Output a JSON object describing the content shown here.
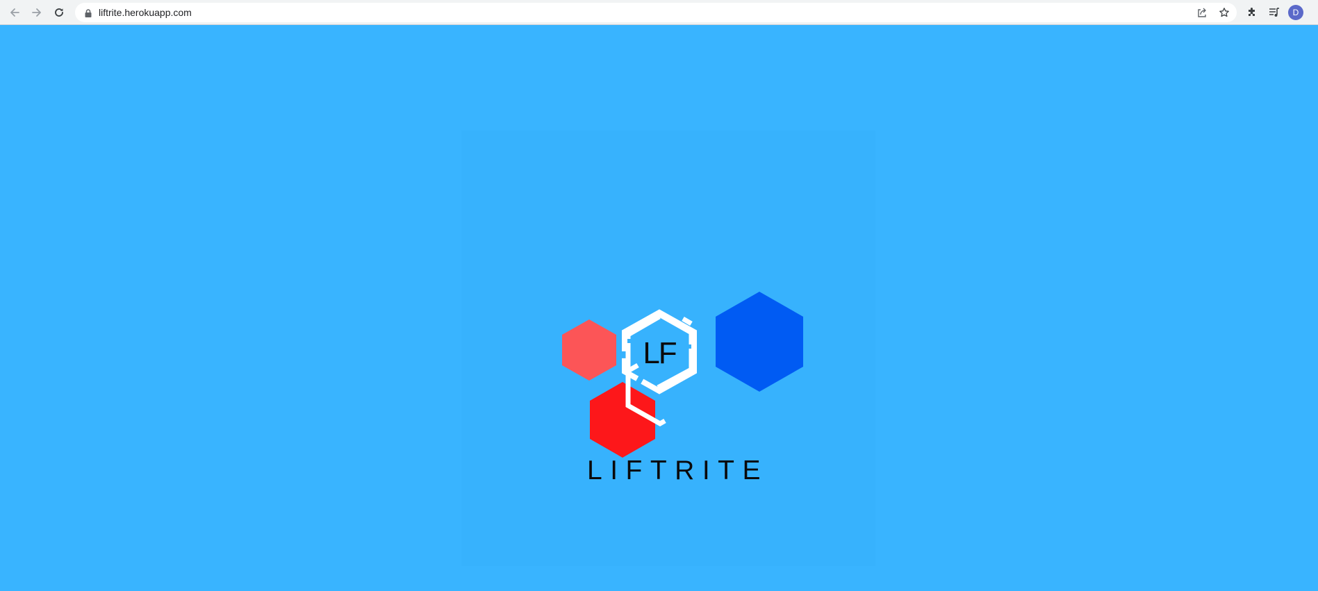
{
  "browser": {
    "url": "liftrite.herokuapp.com",
    "profile_initial": "D",
    "icons": {
      "back": "back-arrow-icon",
      "forward": "forward-arrow-icon",
      "reload": "reload-icon",
      "lock": "lock-icon",
      "share": "share-icon",
      "bookmark": "star-icon",
      "extensions": "puzzle-icon",
      "media": "media-queue-icon"
    }
  },
  "page": {
    "background_color": "#39b4ff",
    "logo": {
      "monogram": "LF",
      "brand": "LIFTRITE",
      "colors": {
        "coral": "#fc5557",
        "red": "#fd171a",
        "blue": "#005bf3",
        "white": "#ffffff"
      }
    }
  }
}
